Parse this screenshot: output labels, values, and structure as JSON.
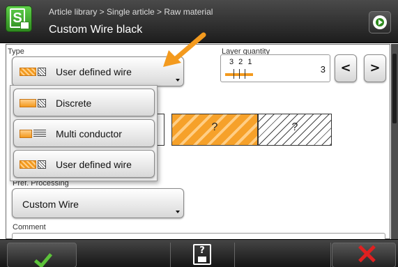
{
  "header": {
    "breadcrumb": "Article library > Single article > Raw material",
    "title": "Custom Wire black"
  },
  "type": {
    "label": "Type",
    "selected": "User defined wire",
    "options": [
      "Discrete",
      "Multi conductor",
      "User defined wire"
    ]
  },
  "layer_quantity": {
    "label": "Layer quantity",
    "indicator": "3 2 1",
    "value": "3",
    "prev": "<",
    "next": ">"
  },
  "layers": {
    "layer1": "?",
    "layer2": "?"
  },
  "pref_processing": {
    "label": "Pref. Processing",
    "value": "Custom Wire"
  },
  "comment": {
    "label": "Comment"
  },
  "save": {
    "glyph": "?"
  },
  "colors": {
    "accent": "#f39a1e",
    "confirm": "#5cc23a",
    "cancel": "#e02020",
    "header": "#1d1d1d"
  }
}
